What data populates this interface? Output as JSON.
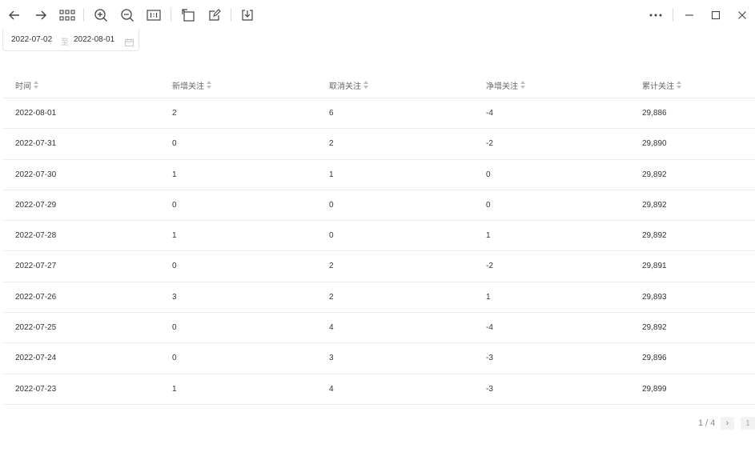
{
  "toolbar": {
    "icons": [
      "back-arrow-icon",
      "forward-arrow-icon",
      "grid-icon",
      "zoom-in-icon",
      "zoom-out-icon",
      "actual-size-icon",
      "rotate-icon",
      "edit-icon",
      "download-icon",
      "more-icon",
      "minimize-icon",
      "maximize-icon",
      "close-icon"
    ]
  },
  "date_range": {
    "start": "2022-07-02",
    "separator": "至",
    "end": "2022-08-01"
  },
  "table": {
    "headers": [
      "时间",
      "新增关注",
      "取消关注",
      "净增关注",
      "累计关注"
    ],
    "rows": [
      [
        "2022-08-01",
        "2",
        "6",
        "-4",
        "29,886"
      ],
      [
        "2022-07-31",
        "0",
        "2",
        "-2",
        "29,890"
      ],
      [
        "2022-07-30",
        "1",
        "1",
        "0",
        "29,892"
      ],
      [
        "2022-07-29",
        "0",
        "0",
        "0",
        "29,892"
      ],
      [
        "2022-07-28",
        "1",
        "0",
        "1",
        "29,892"
      ],
      [
        "2022-07-27",
        "0",
        "2",
        "-2",
        "29,891"
      ],
      [
        "2022-07-26",
        "3",
        "2",
        "1",
        "29,893"
      ],
      [
        "2022-07-25",
        "0",
        "4",
        "-4",
        "29,892"
      ],
      [
        "2022-07-24",
        "0",
        "3",
        "-3",
        "29,896"
      ],
      [
        "2022-07-23",
        "1",
        "4",
        "-3",
        "29,899"
      ]
    ]
  },
  "pagination": {
    "status": "1 / 4",
    "next": "›",
    "page": "1"
  }
}
